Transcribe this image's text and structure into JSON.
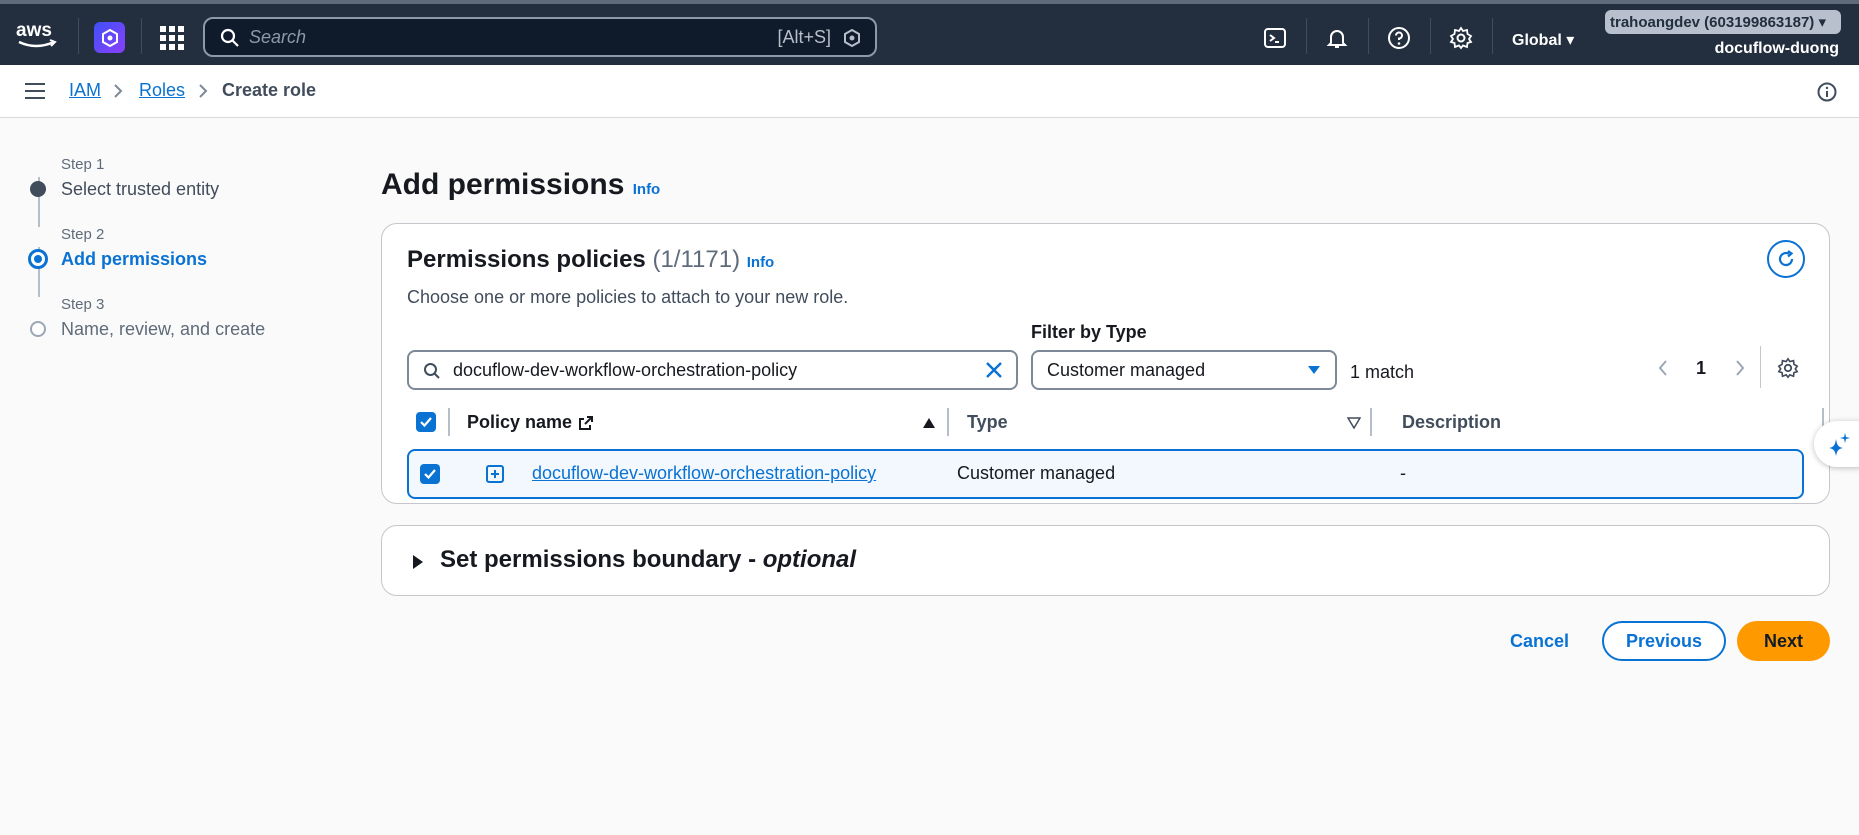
{
  "topnav": {
    "search_placeholder": "Search",
    "search_shortcut": "[Alt+S]",
    "region": "Global",
    "account": "trahoangdev (603199863187)",
    "user": "docuflow-duong"
  },
  "breadcrumb": {
    "items": [
      "IAM",
      "Roles",
      "Create role"
    ]
  },
  "steps": [
    {
      "label": "Step 1",
      "title": "Select trusted entity",
      "state": "done"
    },
    {
      "label": "Step 2",
      "title": "Add permissions",
      "state": "current"
    },
    {
      "label": "Step 3",
      "title": "Name, review, and create",
      "state": "pending"
    }
  ],
  "page": {
    "title": "Add permissions",
    "info": "Info"
  },
  "policies": {
    "title": "Permissions policies",
    "count": "(1/1171)",
    "info": "Info",
    "description": "Choose one or more policies to attach to your new role.",
    "filter_value": "docuflow-dev-workflow-orchestration-policy",
    "filter_type_label": "Filter by Type",
    "filter_type_value": "Customer managed",
    "match_count": "1 match",
    "page": "1",
    "columns": [
      "Policy name",
      "Type",
      "Description"
    ],
    "rows": [
      {
        "name": "docuflow-dev-workflow-orchestration-policy",
        "type": "Customer managed",
        "description": "-"
      }
    ]
  },
  "boundary": {
    "title": "Set permissions boundary - ",
    "optional": "optional"
  },
  "actions": {
    "cancel": "Cancel",
    "previous": "Previous",
    "next": "Next"
  },
  "colors": {
    "accent": "#0972d3",
    "primary_button": "#ff9900",
    "nav_bg": "#232f3e"
  }
}
